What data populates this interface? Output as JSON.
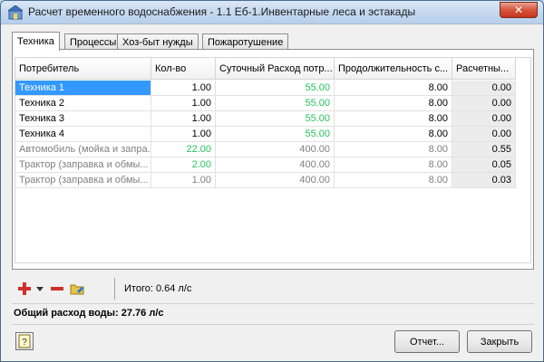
{
  "window": {
    "title": "Расчет временного водоснабжения - 1.1 Еб-1.Инвентарные леса и эстакады",
    "close_glyph": "✕"
  },
  "tabs": [
    {
      "label": "Техника",
      "active": true
    },
    {
      "label": "Процессы",
      "active": false
    },
    {
      "label": "Хоз-быт нужды",
      "active": false
    },
    {
      "label": "Пожаротушение",
      "active": false
    }
  ],
  "table": {
    "columns": [
      "Потребитель",
      "Кол-во",
      "Суточный Расход потр...",
      "Продолжительность с...",
      "Расчетны..."
    ],
    "rows": [
      {
        "name": "Техника 1",
        "qty": "1.00",
        "daily": "55.00",
        "duration": "8.00",
        "calc": "0.00",
        "selected": true,
        "dim": false,
        "qty_green": false,
        "daily_green": true
      },
      {
        "name": "Техника 2",
        "qty": "1.00",
        "daily": "55.00",
        "duration": "8.00",
        "calc": "0.00",
        "selected": false,
        "dim": false,
        "qty_green": false,
        "daily_green": true
      },
      {
        "name": "Техника 3",
        "qty": "1.00",
        "daily": "55.00",
        "duration": "8.00",
        "calc": "0.00",
        "selected": false,
        "dim": false,
        "qty_green": false,
        "daily_green": true
      },
      {
        "name": "Техника 4",
        "qty": "1.00",
        "daily": "55.00",
        "duration": "8.00",
        "calc": "0.00",
        "selected": false,
        "dim": false,
        "qty_green": false,
        "daily_green": true
      },
      {
        "name": "Автомобиль (мойка и запрa...",
        "qty": "22.00",
        "daily": "400.00",
        "duration": "8.00",
        "calc": "0.55",
        "selected": false,
        "dim": true,
        "qty_green": true,
        "daily_green": false
      },
      {
        "name": "Трактор (заправка и обмы...",
        "qty": "2.00",
        "daily": "400.00",
        "duration": "8.00",
        "calc": "0.05",
        "selected": false,
        "dim": true,
        "qty_green": true,
        "daily_green": false
      },
      {
        "name": "Трактор (заправка и обмы...",
        "qty": "1.00",
        "daily": "400.00",
        "duration": "8.00",
        "calc": "0.03",
        "selected": false,
        "dim": true,
        "qty_green": false,
        "daily_green": false
      }
    ]
  },
  "toolbar": {
    "total": "Итого: 0.64 л/с",
    "icons": [
      "add-icon",
      "dropdown-arrow-icon",
      "remove-icon",
      "folder-edit-icon"
    ]
  },
  "summary": "Общий расход воды: 27.76 л/с",
  "buttons": {
    "report": "Отчет...",
    "close": "Закрыть"
  },
  "colors": {
    "selection": "#3399ff",
    "green_value": "#27c25b",
    "add_icon": "#d0302a"
  }
}
